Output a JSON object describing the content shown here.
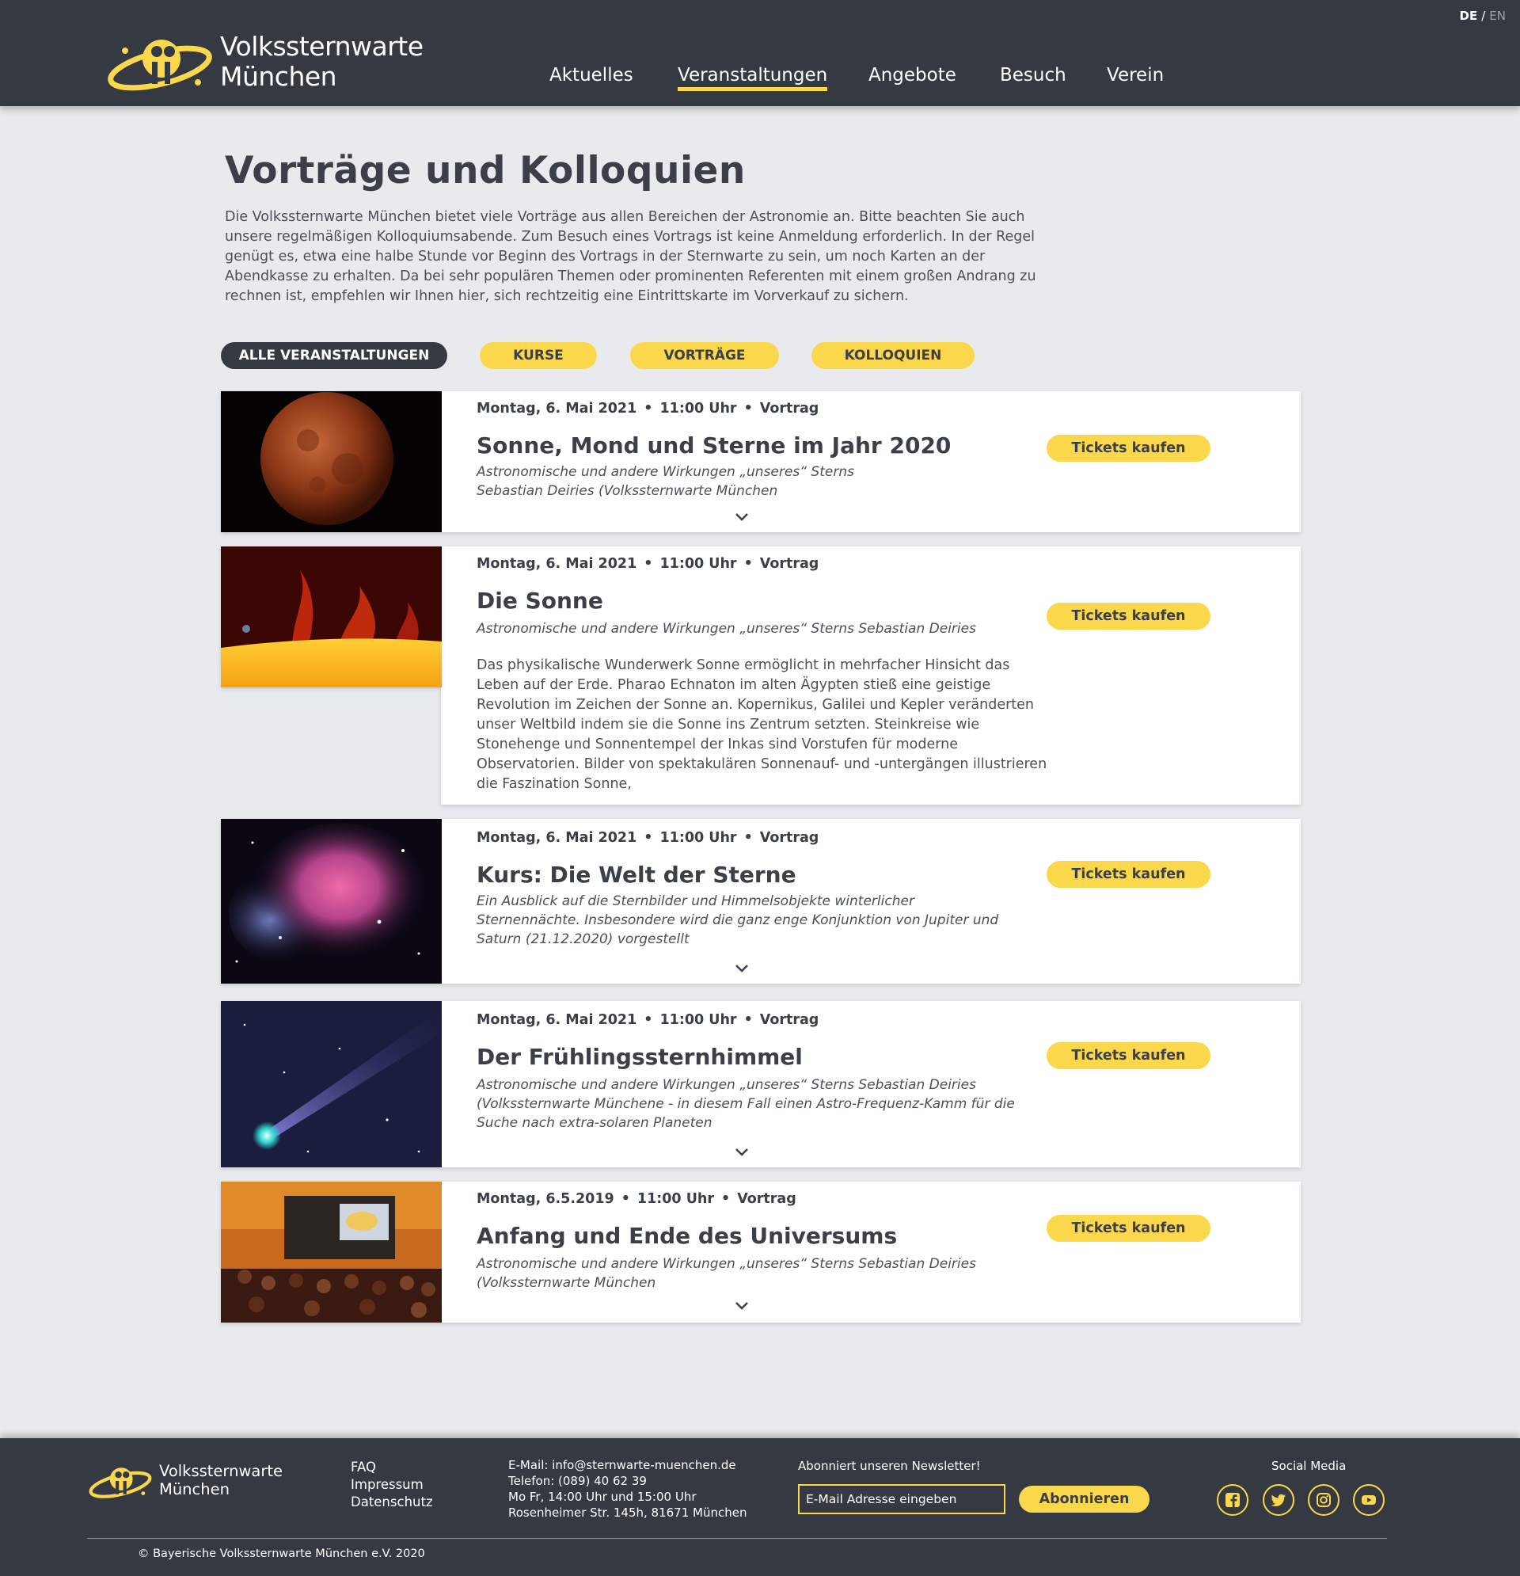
{
  "header": {
    "brand": {
      "line1": "Volkssternwarte",
      "line2": "München"
    },
    "lang": {
      "active": "DE",
      "sep": "/",
      "inactive": "EN"
    },
    "nav": [
      "Aktuelles",
      "Veranstaltungen",
      "Angebote",
      "Besuch",
      "Verein"
    ],
    "nav_active": "Veranstaltungen"
  },
  "page": {
    "title": "Vorträge und Kolloquien",
    "intro": "Die Volkssternwarte München bietet viele Vorträge aus allen Bereichen der Astronomie an. Bitte beachten Sie auch unsere regelmäßigen Kolloquiumsabende. Zum Besuch eines Vortrags ist keine Anmeldung erforderlich. In der Regel genügt es, etwa eine halbe Stunde vor Beginn des Vortrags in der Sternwarte zu sein, um noch Karten an der Abendkasse zu erhalten. Da bei sehr populären Themen oder prominenten Referenten mit einem großen Andrang zu rechnen ist, empfehlen wir Ihnen hier, sich rechtzeitig eine Eintrittskarte im Vorverkauf zu sichern."
  },
  "filters": [
    "ALLE VERANSTALTUNGEN",
    "KURSE",
    "VORTRÄGE",
    "KOLLOQUIEN"
  ],
  "events": [
    {
      "date": "Montag, 6. Mai 2021",
      "time": "11:00 Uhr",
      "type": "Vortrag",
      "title": "Sonne, Mond und Sterne im Jahr 2020",
      "subtitle": "Astronomische und andere Wirkungen „unseres“ Sterns Sebastian Deiries (Volkssternwarte München",
      "ticket_label": "Tickets kaufen",
      "image": "blood-moon-image"
    },
    {
      "date": "Montag, 6. Mai 2021",
      "time": "11:00 Uhr",
      "type": "Vortrag",
      "title": "Die Sonne",
      "subtitle": "Astronomische und andere Wirkungen „unseres“ Sterns Sebastian Deiries",
      "description": "Das physikalische Wunderwerk Sonne ermöglicht in mehrfacher Hinsicht das Leben auf der Erde. Pharao Echnaton im alten Ägypten stieß eine geistige Revolution im Zeichen der Sonne an. Kopernikus, Galilei und Kepler veränderten unser Weltbild indem sie die Sonne ins Zentrum setzten. Steinkreise wie Stonehenge und Sonnentempel der Inkas sind Vorstufen für moderne Observatorien. Bilder von spektakulären Sonnenauf- und -untergängen illustrieren die Faszination Sonne,",
      "ticket_label": "Tickets kaufen",
      "image": "sun-prominence-image"
    },
    {
      "date": "Montag, 6. Mai 2021",
      "time": "11:00 Uhr",
      "type": "Vortrag",
      "title": "Kurs: Die Welt der Sterne",
      "subtitle": "Ein Ausblick auf die Sternbilder und Himmelsobjekte winterlicher Sternennächte. Insbesondere wird die ganz enge Konjunktion von Jupiter und Saturn (21.12.2020) vorgestellt",
      "ticket_label": "Tickets kaufen",
      "image": "nebula-image"
    },
    {
      "date": "Montag, 6. Mai 2021",
      "time": "11:00 Uhr",
      "type": "Vortrag",
      "title": "Der Frühlingssternhimmel",
      "subtitle": "Astronomische und andere Wirkungen „unseres“ Sterns Sebastian Deiries (Volkssternwarte Münchene - in diesem Fall einen Astro-Frequenz-Kamm für die Suche nach extra-solaren Planeten",
      "ticket_label": "Tickets kaufen",
      "image": "comet-image"
    },
    {
      "date": "Montag, 6.5.2019",
      "time": "11:00 Uhr",
      "type": "Vortrag",
      "title": "Anfang und Ende des Universums",
      "subtitle": "Astronomische und andere Wirkungen „unseres“ Sterns Sebastian Deiries (Volkssternwarte München",
      "ticket_label": "Tickets kaufen",
      "image": "lecture-hall-image"
    }
  ],
  "footer": {
    "brand": {
      "line1": "Volkssternwarte",
      "line2": "München"
    },
    "links": [
      "FAQ",
      "Impressum",
      "Datenschutz"
    ],
    "contact": [
      "E-Mail: info@sternwarte-muenchen.de",
      "Telefon: (089) 40 62 39",
      "Mo Fr,  14:00 Uhr und 15:00 Uhr",
      "Rosenheimer Str. 145h, 81671 München"
    ],
    "newsletter_label": "Abonniert unseren Newsletter!",
    "newsletter_placeholder": "E-Mail Adresse eingeben",
    "subscribe_label": "Abonnieren",
    "social_label": "Social Media",
    "social_icons": [
      "facebook-icon",
      "twitter-icon",
      "instagram-icon",
      "youtube-icon"
    ],
    "copyright": "© Bayerische Volkssternwarte München e.V. 2020"
  },
  "colors": {
    "accent": "#fbd74b",
    "dark": "#353a42",
    "background": "#e9eaee"
  }
}
